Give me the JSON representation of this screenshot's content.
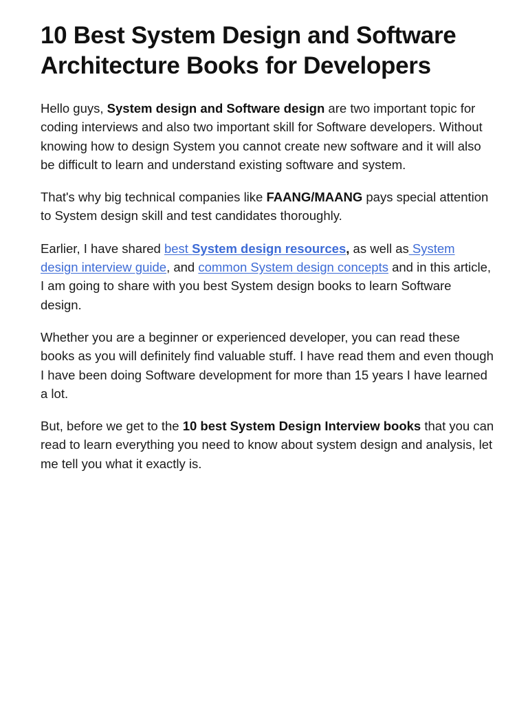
{
  "article": {
    "title": "10 Best System Design and Software Architecture Books for Developers",
    "p1": {
      "t1": "Hello guys, ",
      "b1": "System design and Software design",
      "t2": " are two important topic for coding interviews and also two important skill for Software developers. Without knowing how to design System you cannot create new software and it will also be difficult to learn and understand existing software and system."
    },
    "p2": {
      "t1": "That's why big technical companies like ",
      "b1": "FAANG/MAANG",
      "t2": " pays special attention to System design skill and test candidates thoroughly."
    },
    "p3": {
      "t1": "Earlier, I have shared ",
      "link1_a": "best ",
      "link1_b": "System design resources",
      "t2": ",",
      "t3": " as well as",
      "link2": " System design interview guide",
      "t4": ",  and ",
      "link3": "common System design concepts",
      "t5": " and in this article, I am going to share with you best System design books to learn Software design."
    },
    "p4": {
      "t1": "Whether you are a beginner or experienced developer, you can read these books as you will definitely find valuable stuff. I have read them and even though I have been doing Software development for more than 15 years I have learned a lot."
    },
    "p5": {
      "t1": "But, before we get to the ",
      "b1": "10 best System Design Interview books",
      "t2": " that you can read to learn everything you need to know about system design and analysis, let me tell you what it exactly is."
    }
  }
}
